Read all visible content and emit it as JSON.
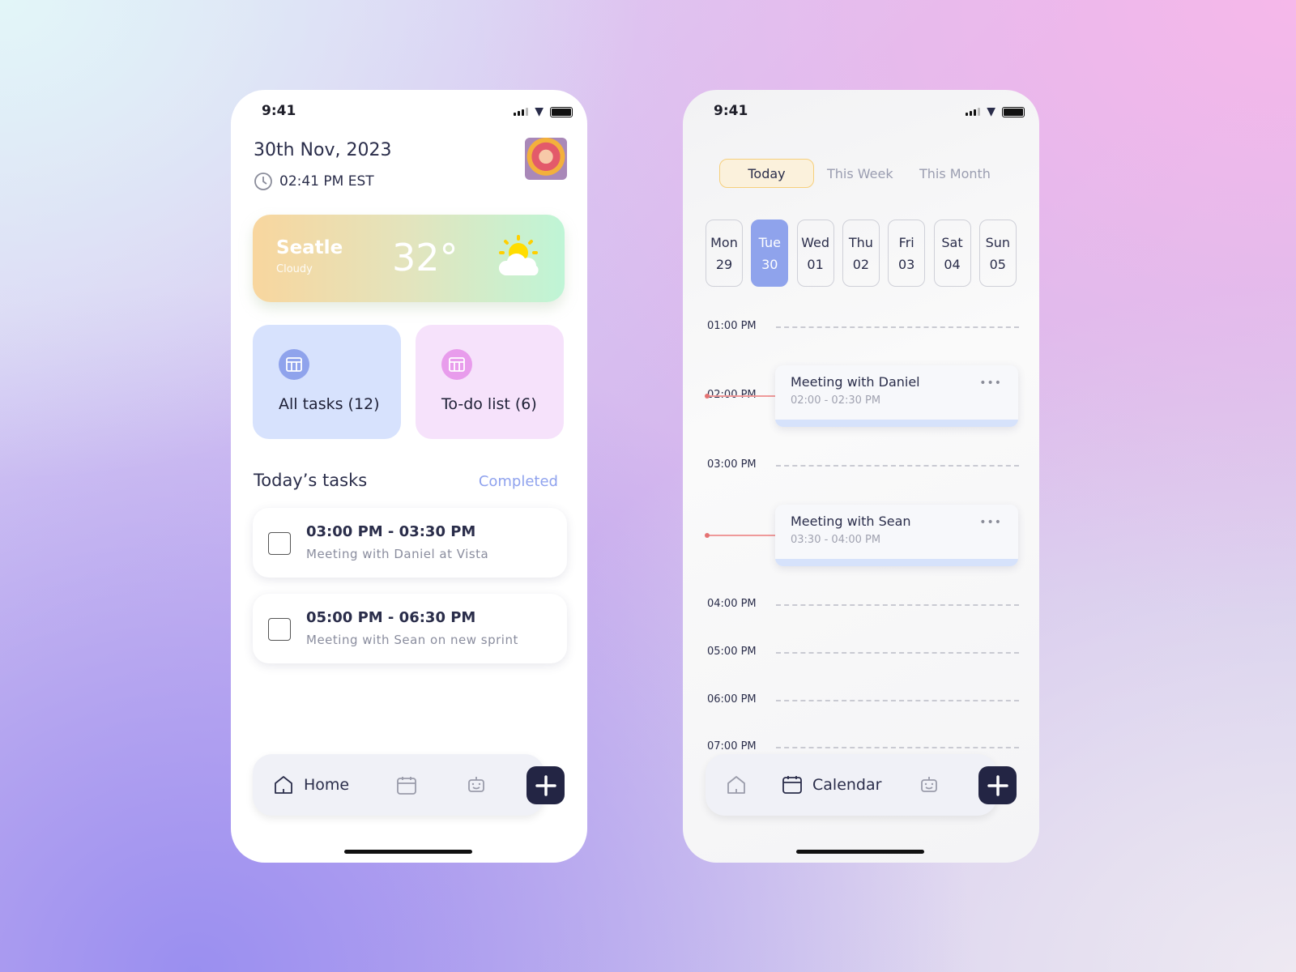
{
  "status": {
    "time": "9:41"
  },
  "home": {
    "date": "30th Nov, 2023",
    "clock": "02:41 PM EST",
    "weather": {
      "city": "Seatle",
      "condition": "Cloudy",
      "temp": "32°",
      "icon": "sun-cloud-icon"
    },
    "cards": [
      {
        "label": "All tasks (12)",
        "color": "#d7e2fd",
        "icon_color": "#8fa3ec"
      },
      {
        "label": "To-do list (6)",
        "color": "#f6e2fb",
        "icon_color": "#e89cec"
      }
    ],
    "section_title": "Today’s tasks",
    "completed_link": "Completed",
    "tasks": [
      {
        "time": "03:00 PM - 03:30 PM",
        "desc": "Meeting with Daniel at Vista",
        "done": false
      },
      {
        "time": "05:00 PM - 06:30 PM",
        "desc": "Meeting with Sean on new sprint",
        "done": false
      }
    ],
    "nav": {
      "active": "Home"
    }
  },
  "calendar": {
    "tabs": [
      "Today",
      "This Week",
      "This Month"
    ],
    "active_tab": "Today",
    "days": [
      {
        "d": "Mon",
        "n": "29"
      },
      {
        "d": "Tue",
        "n": "30"
      },
      {
        "d": "Wed",
        "n": "01"
      },
      {
        "d": "Thu",
        "n": "02"
      },
      {
        "d": "Fri",
        "n": "03"
      },
      {
        "d": "Sat",
        "n": "04"
      },
      {
        "d": "Sun",
        "n": "05"
      }
    ],
    "selected_day": "Tue",
    "hours": [
      "01:00 PM",
      "02:00 PM",
      "03:00 PM",
      "04:00 PM",
      "05:00 PM",
      "06:00 PM",
      "07:00 PM"
    ],
    "events": [
      {
        "title": "Meeting with Daniel",
        "time": "02:00 - 02:30 PM"
      },
      {
        "title": "Meeting with Sean",
        "time": "03:30 - 04:00 PM"
      }
    ],
    "more": "•••",
    "nav": {
      "active": "Calendar"
    }
  }
}
